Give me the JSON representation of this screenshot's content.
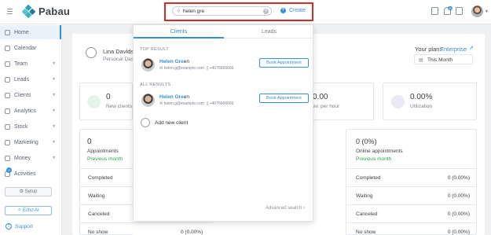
{
  "app": {
    "name": "Pabau"
  },
  "search": {
    "value": "helen gre",
    "create_label": "Create"
  },
  "sidebar": {
    "items": [
      {
        "label": "Home",
        "icon": "home-icon",
        "has_caret": false
      },
      {
        "label": "Calendar",
        "icon": "calendar-icon",
        "has_caret": false
      },
      {
        "label": "Team",
        "icon": "team-icon",
        "has_caret": true
      },
      {
        "label": "Leads",
        "icon": "leads-icon",
        "has_caret": true
      },
      {
        "label": "Clients",
        "icon": "clients-icon",
        "has_caret": true
      },
      {
        "label": "Analytics",
        "icon": "analytics-icon",
        "has_caret": true
      },
      {
        "label": "Stock",
        "icon": "stock-icon",
        "has_caret": true
      },
      {
        "label": "Marketing",
        "icon": "marketing-icon",
        "has_caret": true
      },
      {
        "label": "Money",
        "icon": "money-icon",
        "has_caret": true
      },
      {
        "label": "Activities",
        "icon": "activities-icon",
        "has_caret": false,
        "badge": "5"
      }
    ],
    "setup_label": "Setup",
    "echo_label": "Echo AI",
    "support_label": "Support"
  },
  "dashboard": {
    "user_name": "Lina Davidso",
    "user_subtitle": "Personal Das",
    "plan_label": "Your plan:",
    "plan_value": "Enterprise",
    "period": "This Month",
    "stats": [
      {
        "value": "0",
        "label": "New clients"
      },
      {
        "value": "0.00",
        "label": "ev. per hour"
      },
      {
        "value": "0.00%",
        "label": "Utilization"
      }
    ],
    "left_panel": {
      "value": "0",
      "title": "Appointments",
      "compare": "Previous month",
      "rows": [
        {
          "label": "Completed",
          "value": ""
        },
        {
          "label": "Waiting",
          "value": ""
        },
        {
          "label": "Canceled",
          "value": ""
        },
        {
          "label": "No show",
          "value": "0 (0.00%)"
        }
      ]
    },
    "right_panel": {
      "value": "0 (0%)",
      "title": "Online appointments",
      "compare": "Previous month",
      "rows": [
        {
          "label": "Completed",
          "value": "0 (0.00%)"
        },
        {
          "label": "Waiting",
          "value": "0 (0.00%)"
        },
        {
          "label": "Canceled",
          "value": "0 (0.00%)"
        },
        {
          "label": "No show",
          "value": "0 (0.00%)"
        }
      ]
    }
  },
  "dropdown": {
    "tabs": [
      "Clients",
      "Leads"
    ],
    "top_result_label": "TOP RESULT",
    "all_results_label": "ALL RESULTS",
    "results": [
      {
        "name_match": "Helen Gre",
        "name_rest": "en",
        "email": "helen.g@example.com",
        "phone": "+4076666666",
        "action": "Book Appointment"
      },
      {
        "name_match": "Helen Gre",
        "name_rest": "en",
        "email": "helen.g@example.com",
        "phone": "+4076666666",
        "action": "Book Appointment"
      }
    ],
    "add_new_label": "Add new client",
    "advanced_label": "Advanced search"
  },
  "colors": {
    "accent": "#3a8fd6",
    "highlight_border": "#d72a2a",
    "positive": "#2f9e4f"
  }
}
